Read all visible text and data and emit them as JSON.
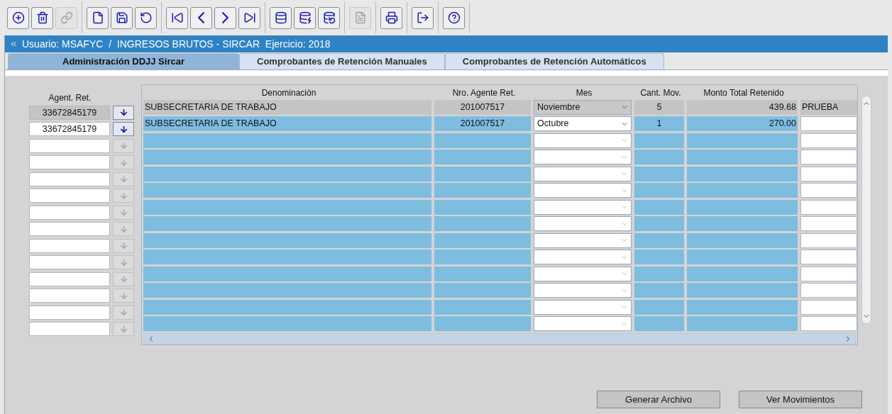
{
  "toolbar": [
    [
      {
        "kind": "add",
        "disabled": false
      },
      {
        "kind": "delete",
        "disabled": false
      },
      {
        "kind": "link",
        "disabled": true
      }
    ],
    [
      {
        "kind": "new",
        "disabled": false
      },
      {
        "kind": "save",
        "disabled": false
      },
      {
        "kind": "undo",
        "disabled": false
      }
    ],
    [
      {
        "kind": "first",
        "disabled": false
      },
      {
        "kind": "previous",
        "disabled": false
      },
      {
        "kind": "next",
        "disabled": false
      },
      {
        "kind": "last",
        "disabled": false
      }
    ],
    [
      {
        "kind": "query",
        "disabled": false
      },
      {
        "kind": "search",
        "disabled": false
      },
      {
        "kind": "execute",
        "disabled": false
      }
    ],
    [
      {
        "kind": "report",
        "disabled": true
      }
    ],
    [
      {
        "kind": "print",
        "disabled": false
      }
    ],
    [
      {
        "kind": "exit",
        "disabled": false
      }
    ],
    [
      {
        "kind": "help",
        "disabled": false
      }
    ]
  ],
  "window": {
    "title": "Usuario: MSAFYC  /  INGRESOS BRUTOS - SIRCAR  Ejercicio: 2018"
  },
  "tabs": [
    {
      "label": "Administración DDJJ Sircar",
      "selected": true
    },
    {
      "label": "Comprobantes de Retención Manuales",
      "selected": false
    },
    {
      "label": "Comprobantes de Retención Automáticos",
      "selected": false
    }
  ],
  "agents": {
    "heading": "Agent. Ret.",
    "items": [
      {
        "value": "33672845179",
        "selected": true,
        "button_disabled": false
      },
      {
        "value": "33672845179",
        "selected": false,
        "button_disabled": false
      },
      {
        "selected": false,
        "button_disabled": true
      },
      {
        "selected": false,
        "button_disabled": true
      },
      {
        "selected": false,
        "button_disabled": true
      },
      {
        "selected": false,
        "button_disabled": true
      },
      {
        "selected": false,
        "button_disabled": true
      },
      {
        "selected": false,
        "button_disabled": true
      },
      {
        "selected": false,
        "button_disabled": true
      },
      {
        "selected": false,
        "button_disabled": true
      },
      {
        "selected": false,
        "button_disabled": true
      },
      {
        "selected": false,
        "button_disabled": true
      },
      {
        "selected": false,
        "button_disabled": true
      },
      {
        "selected": false,
        "button_disabled": true
      }
    ]
  },
  "table": {
    "columns": [
      "Denominación",
      "Nro. Agente Ret.",
      "Mes",
      "Cant. Mov.",
      "Monto Total Retenido"
    ],
    "rows": [
      {
        "selected": true,
        "cells": [
          "SUBSECRETARIA DE TRABAJO",
          "201007517",
          "Noviembre",
          "5",
          "439.68",
          "PRUEBA"
        ]
      },
      {
        "selected": false,
        "cells": [
          "SUBSECRETARIA DE TRABAJO",
          "201007517",
          "Octubre",
          "1",
          "270.00"
        ]
      },
      {
        "selected": false
      },
      {
        "selected": false
      },
      {
        "selected": false
      },
      {
        "selected": false
      },
      {
        "selected": false
      },
      {
        "selected": false
      },
      {
        "selected": false
      },
      {
        "selected": false
      },
      {
        "selected": false
      },
      {
        "selected": false
      },
      {
        "selected": false
      },
      {
        "selected": false
      }
    ]
  },
  "buttons": [
    "Generar Archivo",
    "Ver Movimientos"
  ]
}
